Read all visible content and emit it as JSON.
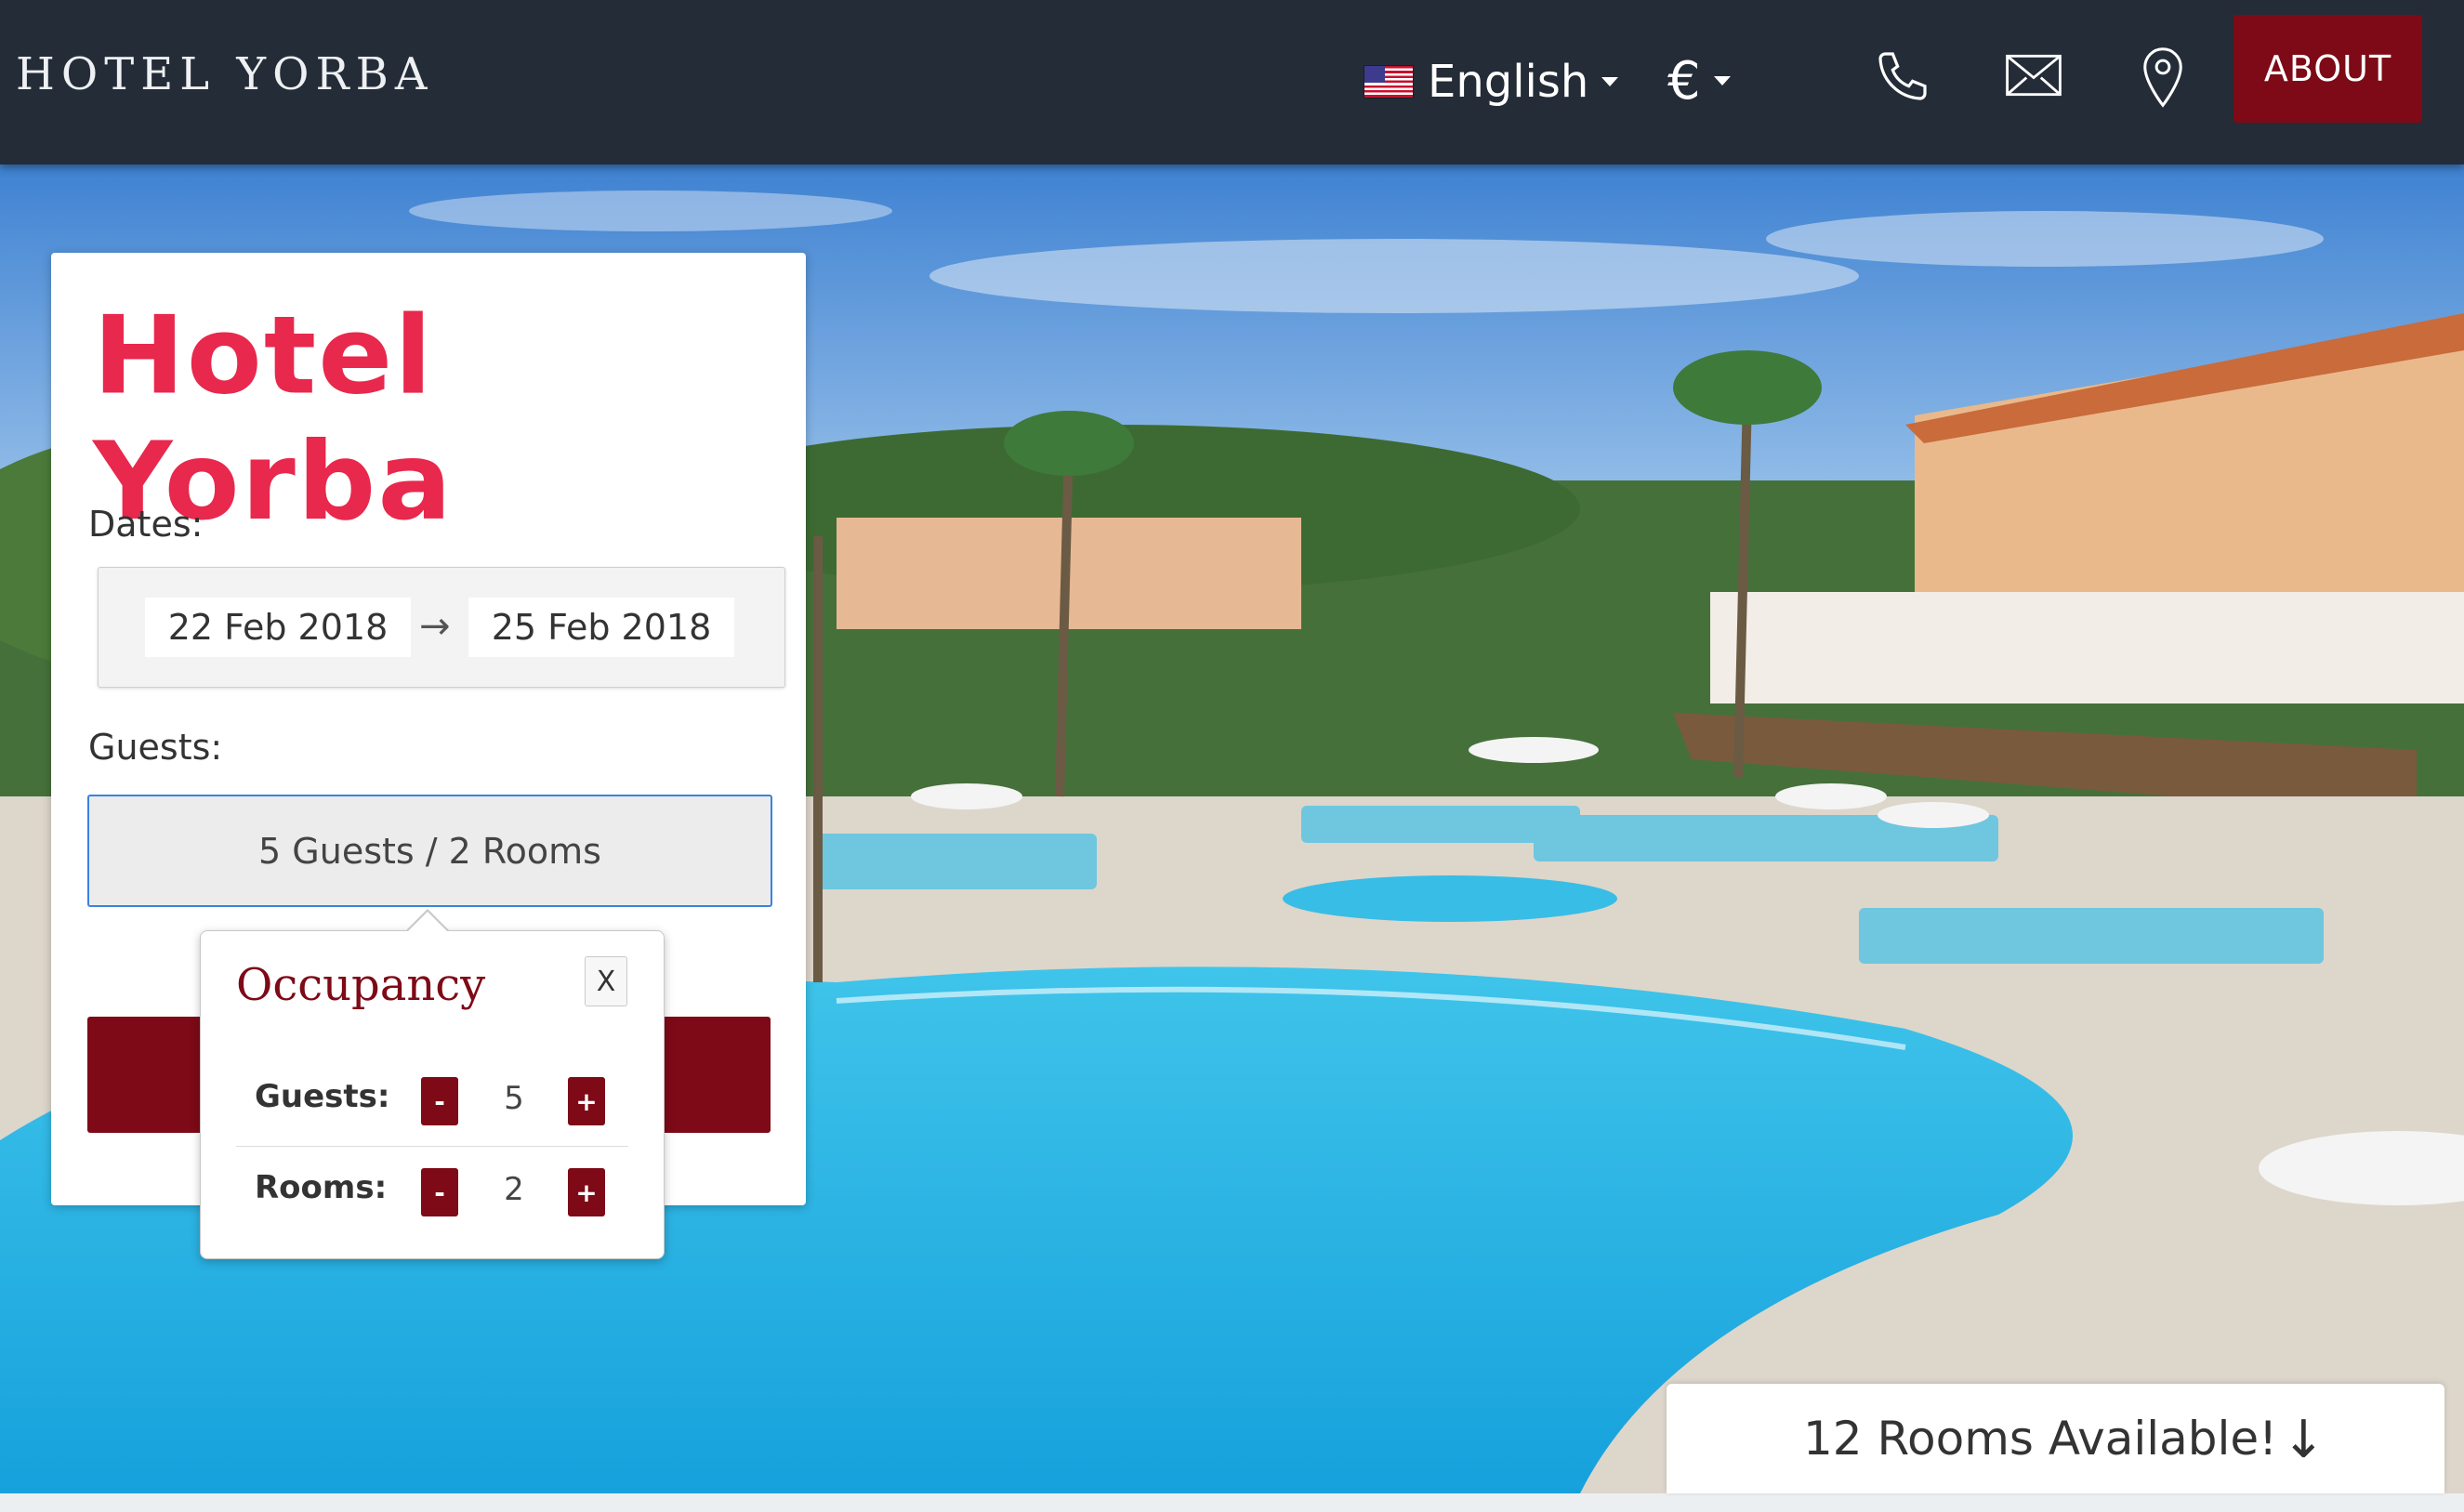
{
  "nav": {
    "brand": "HOTEL YORBA",
    "language": "English",
    "currency": "€",
    "about_label": "ABOUT",
    "icons": [
      "phone-icon",
      "envelope-icon",
      "map-pin-icon",
      "us-flag-icon"
    ]
  },
  "card": {
    "logo": "Hotel Yorba",
    "dates_label": "Dates:",
    "check_in": "22 Feb 2018",
    "arrow": "→",
    "check_out": "25 Feb 2018",
    "guests_label": "Guests:",
    "guests_summary": "5 Guests / 2 Rooms"
  },
  "occupancy": {
    "title": "Occupancy",
    "close": "X",
    "guests_label": "Guests:",
    "guests_value": "5",
    "rooms_label": "Rooms:",
    "rooms_value": "2",
    "minus": "-",
    "plus": "+"
  },
  "availability": {
    "text": "12 Rooms Available!",
    "arrow": "↓"
  },
  "colors": {
    "nav_bg": "#242c37",
    "accent": "#7d0a16",
    "logo": "#e8284c",
    "focus": "#3b82e0"
  }
}
